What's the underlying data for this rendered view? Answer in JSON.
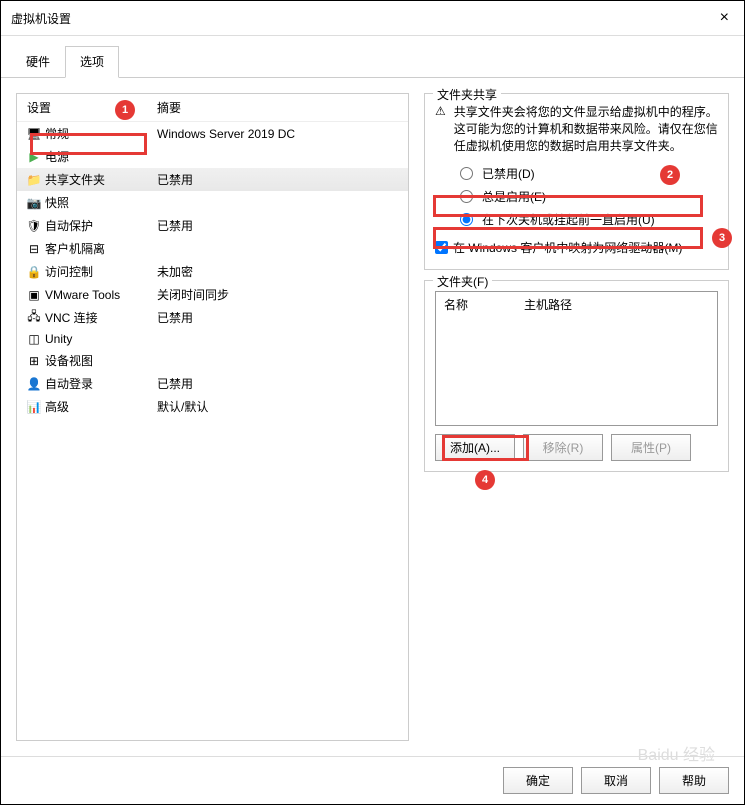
{
  "window": {
    "title": "虚拟机设置"
  },
  "tabs": {
    "hardware": "硬件",
    "options": "选项"
  },
  "list": {
    "header_setting": "设置",
    "header_summary": "摘要",
    "items": [
      {
        "name": "常规",
        "value": "Windows Server 2019 DC"
      },
      {
        "name": "电源",
        "value": ""
      },
      {
        "name": "共享文件夹",
        "value": "已禁用"
      },
      {
        "name": "快照",
        "value": ""
      },
      {
        "name": "自动保护",
        "value": "已禁用"
      },
      {
        "name": "客户机隔离",
        "value": ""
      },
      {
        "name": "访问控制",
        "value": "未加密"
      },
      {
        "name": "VMware Tools",
        "value": "关闭时间同步"
      },
      {
        "name": "VNC 连接",
        "value": "已禁用"
      },
      {
        "name": "Unity",
        "value": ""
      },
      {
        "name": "设备视图",
        "value": ""
      },
      {
        "name": "自动登录",
        "value": "已禁用"
      },
      {
        "name": "高级",
        "value": "默认/默认"
      }
    ]
  },
  "sharing": {
    "group_title": "文件夹共享",
    "warning": "共享文件夹会将您的文件显示给虚拟机中的程序。这可能为您的计算机和数据带来风险。请仅在您信任虚拟机使用您的数据时启用共享文件夹。",
    "radio_disabled": "已禁用(D)",
    "radio_always": "总是启用(E)",
    "radio_until": "在下次关机或挂起前一直启用(U)",
    "checkbox_map": "在 Windows 客户机中映射为网络驱动器(M)"
  },
  "folders": {
    "group_title": "文件夹(F)",
    "header_name": "名称",
    "header_path": "主机路径",
    "btn_add": "添加(A)...",
    "btn_remove": "移除(R)",
    "btn_props": "属性(P)"
  },
  "footer": {
    "ok": "确定",
    "cancel": "取消",
    "help": "帮助"
  },
  "badges": {
    "b1": "1",
    "b2": "2",
    "b3": "3",
    "b4": "4"
  },
  "watermark": "Baidu 经验"
}
